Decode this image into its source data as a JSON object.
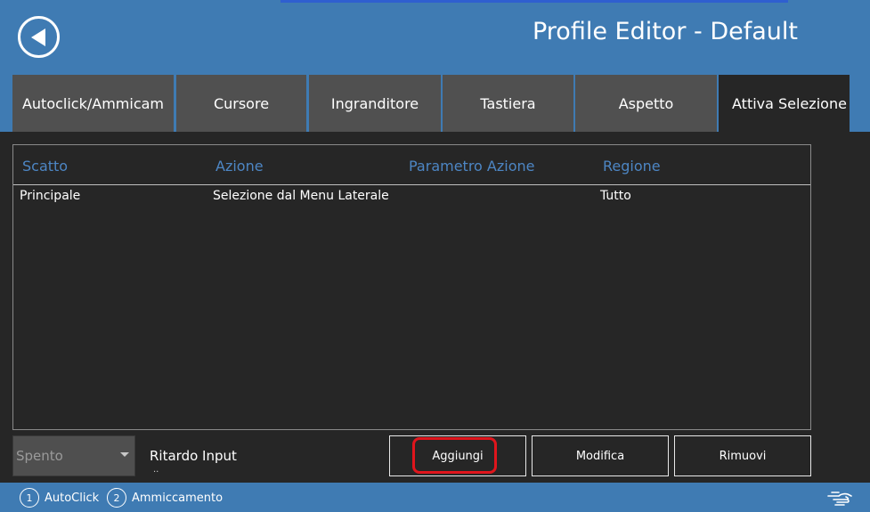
{
  "header": {
    "title": "Profile Editor - Default",
    "back_icon": "back-arrow-icon"
  },
  "tabs": [
    {
      "label": "Autoclick/Ammicam",
      "active": false
    },
    {
      "label": "Cursore",
      "active": false
    },
    {
      "label": "Ingranditore",
      "active": false
    },
    {
      "label": "Tastiera",
      "active": false
    },
    {
      "label": "Aspetto",
      "active": false
    },
    {
      "label": "Attiva Selezione",
      "active": true
    }
  ],
  "table": {
    "columns": [
      "Scatto",
      "Azione",
      "Parametro Azione",
      "Regione"
    ],
    "rows": [
      [
        "Principale",
        "Selezione dal Menu Laterale",
        "",
        "Tutto"
      ]
    ]
  },
  "controls": {
    "select_value": "Spento",
    "delay_label": "Ritardo Input",
    "delay_dots": "..",
    "add_button": "Aggiungi",
    "edit_button": "Modifica",
    "remove_button": "Rimuovi"
  },
  "statusbar": {
    "items": [
      {
        "number": "1",
        "label": "AutoClick"
      },
      {
        "number": "2",
        "label": "Ammiccamento"
      }
    ],
    "hand_icon": "pointing-hand-icon"
  },
  "colors": {
    "accent": "#3f7bb3",
    "background": "#262626",
    "tab": "#505050",
    "column_header": "#4d86c4",
    "highlight": "#e0151c"
  }
}
